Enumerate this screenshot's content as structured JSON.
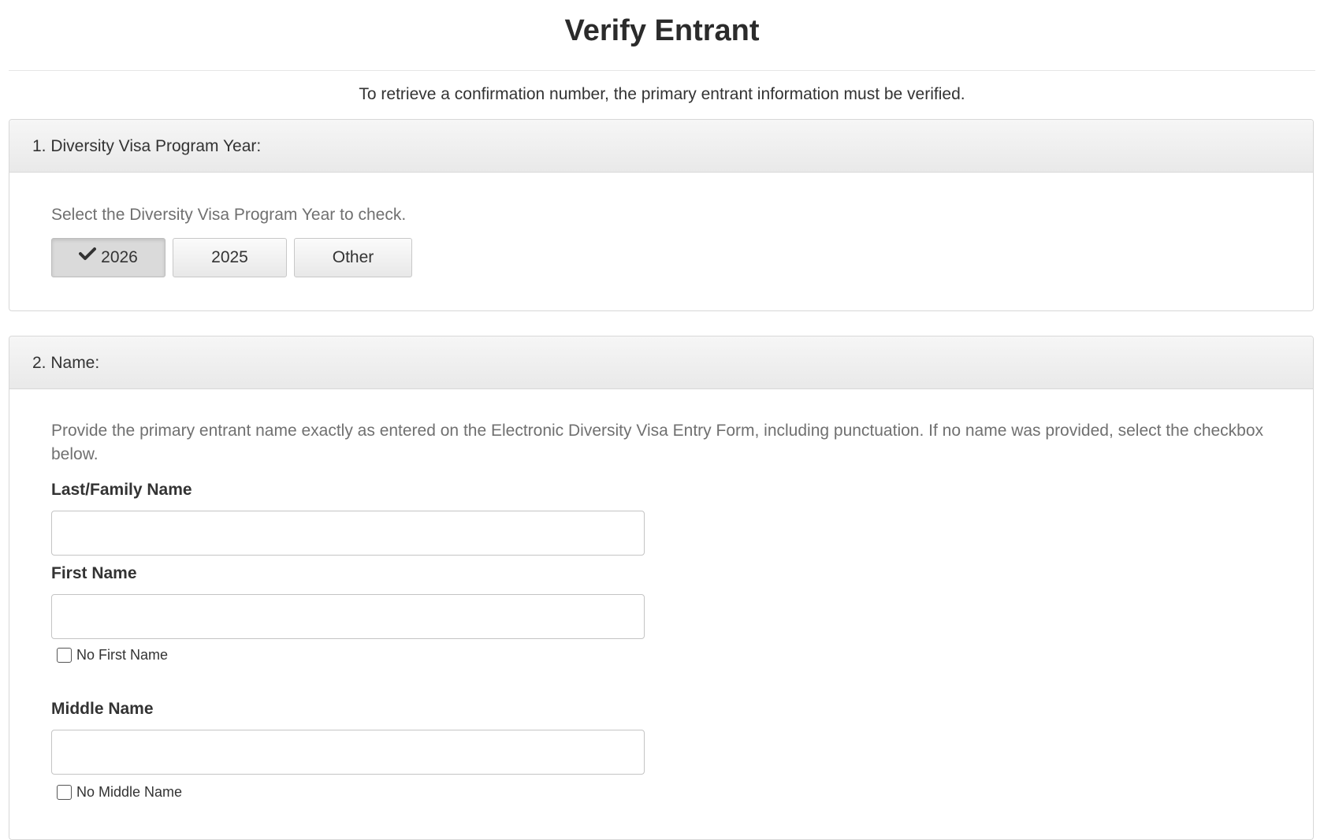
{
  "page": {
    "title": "Verify Entrant",
    "intro": "To retrieve a confirmation number, the primary entrant information must be verified."
  },
  "section_year": {
    "heading": "1. Diversity Visa Program Year:",
    "help": "Select the Diversity Visa Program Year to check.",
    "options": [
      {
        "label": "2026",
        "selected": true
      },
      {
        "label": "2025",
        "selected": false
      },
      {
        "label": "Other",
        "selected": false
      }
    ]
  },
  "section_name": {
    "heading": "2. Name:",
    "help": "Provide the primary entrant name exactly as entered on the Electronic Diversity Visa Entry Form, including punctuation. If no name was provided, select the checkbox below.",
    "last_name": {
      "label": "Last/Family Name",
      "value": ""
    },
    "first_name": {
      "label": "First Name",
      "value": "",
      "no_checkbox_label": "No First Name",
      "no_checked": false
    },
    "middle_name": {
      "label": "Middle Name",
      "value": "",
      "no_checkbox_label": "No Middle Name",
      "no_checked": false
    }
  }
}
